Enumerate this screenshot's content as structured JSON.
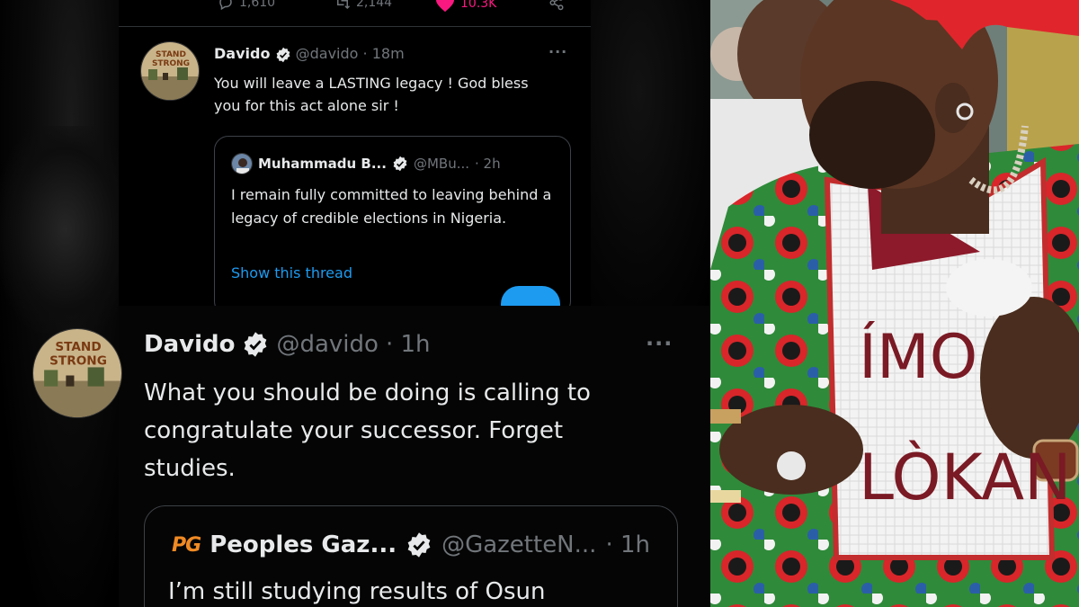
{
  "top_actions": {
    "replies": "1,610",
    "retweets": "2,144",
    "likes": "10.3K"
  },
  "small_tweet": {
    "avatar_text": "STAND STRONG",
    "name": "Davido",
    "handle": "@davido",
    "time": "· 18m",
    "body": "You will leave a LASTING legacy ! God bless you for this act alone sir !",
    "quote": {
      "name": "Muhammadu B...",
      "handle": "@MBu...",
      "time": "· 2h",
      "body": "I remain fully committed to leaving behind a legacy of credible elections in Nigeria.",
      "link": "Show this thread"
    }
  },
  "big_tweet": {
    "avatar_text": "STAND STRONG",
    "name": "Davido",
    "handle": "@davido",
    "time": "· 1h",
    "body": "What you should be doing is calling to congratulate your successor. Forget studies.",
    "quote": {
      "logo": "PG",
      "name": "Peoples Gaz...",
      "handle": "@GazetteN...",
      "time": "· 1h",
      "body": "I’m still studying results of Osun"
    }
  },
  "photo": {
    "sign_line1": "ÍMO",
    "sign_line2": "LÒKAN"
  },
  "colors": {
    "like": "#f91880",
    "link": "#1d9bf0",
    "muted": "#71767b",
    "cap": "#e0262c"
  },
  "icons": [
    "reply-icon",
    "retweet-icon",
    "heart-icon",
    "share-icon",
    "verified-badge-icon",
    "more-icon"
  ]
}
